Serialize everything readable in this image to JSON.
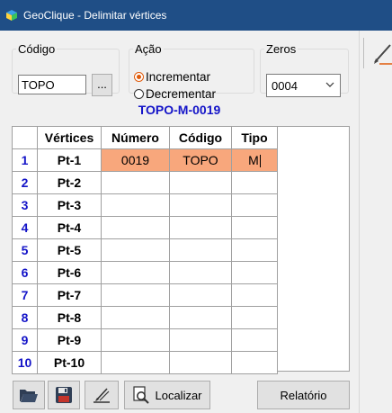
{
  "window": {
    "title": "GeoClique - Delimitar vértices"
  },
  "codigo": {
    "legend": "Código",
    "value": "TOPO",
    "browse_label": "..."
  },
  "acao": {
    "legend": "Ação",
    "options": [
      "Incrementar",
      "Decrementar"
    ],
    "selected": "Incrementar"
  },
  "zeros": {
    "legend": "Zeros",
    "value": "0004"
  },
  "heading": "TOPO-M-0019",
  "grid": {
    "columns": [
      "Vértices",
      "Número",
      "Código",
      "Tipo"
    ],
    "rows": [
      {
        "n": "1",
        "vertice": "Pt-1",
        "numero": "0019",
        "codigo": "TOPO",
        "tipo": "M"
      },
      {
        "n": "2",
        "vertice": "Pt-2",
        "numero": "",
        "codigo": "",
        "tipo": ""
      },
      {
        "n": "3",
        "vertice": "Pt-3",
        "numero": "",
        "codigo": "",
        "tipo": ""
      },
      {
        "n": "4",
        "vertice": "Pt-4",
        "numero": "",
        "codigo": "",
        "tipo": ""
      },
      {
        "n": "5",
        "vertice": "Pt-5",
        "numero": "",
        "codigo": "",
        "tipo": ""
      },
      {
        "n": "6",
        "vertice": "Pt-6",
        "numero": "",
        "codigo": "",
        "tipo": ""
      },
      {
        "n": "7",
        "vertice": "Pt-7",
        "numero": "",
        "codigo": "",
        "tipo": ""
      },
      {
        "n": "8",
        "vertice": "Pt-8",
        "numero": "",
        "codigo": "",
        "tipo": ""
      },
      {
        "n": "9",
        "vertice": "Pt-9",
        "numero": "",
        "codigo": "",
        "tipo": ""
      },
      {
        "n": "10",
        "vertice": "Pt-10",
        "numero": "",
        "codigo": "",
        "tipo": ""
      }
    ],
    "selected_row_color": "#f8a77c",
    "row_number_color": "#1414c8"
  },
  "toolbar": {
    "open_icon": "folder-open-icon",
    "save_icon": "floppy-disk-icon",
    "draw_icon": "pen-ruler-icon",
    "localizar_label": "Localizar",
    "relatorio_label": "Relatório"
  },
  "colors": {
    "titlebar": "#1f4e86",
    "accent": "#1414c8",
    "radio": "#e05a0a"
  }
}
